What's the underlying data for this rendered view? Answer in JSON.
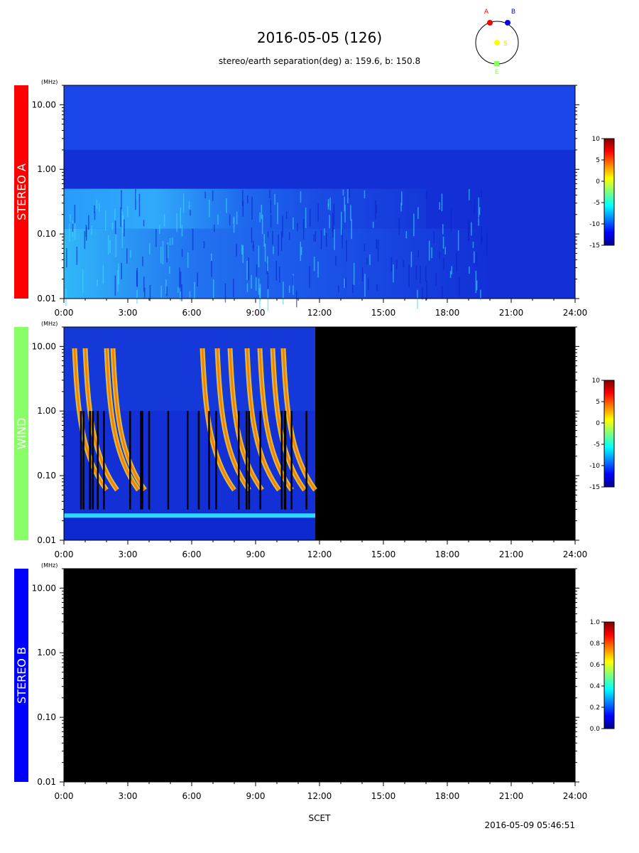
{
  "header": {
    "title": "2016-05-05 (126)",
    "subtitle": "stereo/earth separation(deg) a: 159.6, b: 150.8"
  },
  "orbit": {
    "labels": [
      "A",
      "B",
      "S",
      "E"
    ]
  },
  "footer": {
    "xlabel": "SCET",
    "timestamp": "2016-05-09 05:46:51"
  },
  "chart_data": [
    {
      "type": "heatmap",
      "panel": "STEREO A",
      "panel_color": "#ff0000",
      "panel_text_color": "#ffffff",
      "y_unit_label": "(MHz)",
      "yscale": "log",
      "ylim": [
        0.01,
        20
      ],
      "yticks": [
        10,
        1,
        0.1,
        0.01
      ],
      "ytick_labels": [
        "10.00",
        "1.00",
        "0.10",
        "0.01"
      ],
      "xlim": [
        0,
        24
      ],
      "xticks": [
        0,
        3,
        6,
        9,
        12,
        15,
        18,
        21,
        24
      ],
      "xtick_labels": [
        "0:00",
        "3:00",
        "6:00",
        "9:00",
        "12:00",
        "15:00",
        "18:00",
        "21:00",
        "24:00"
      ],
      "data_end_hour": 24,
      "colorbar": {
        "range": [
          -15,
          10
        ],
        "ticks": [
          10,
          5,
          0,
          -5,
          -10,
          -15
        ],
        "tick_labels": [
          "10",
          "5",
          "0",
          "-5",
          "-10",
          "-15"
        ]
      }
    },
    {
      "type": "heatmap",
      "panel": "WIND",
      "panel_color": "#88ff66",
      "panel_text_color": "#ffffff",
      "y_unit_label": "(MHz)",
      "yscale": "log",
      "ylim": [
        0.01,
        20
      ],
      "yticks": [
        10,
        1,
        0.1,
        0.01
      ],
      "ytick_labels": [
        "10.00",
        "1.00",
        "0.10",
        "0.01"
      ],
      "xlim": [
        0,
        24
      ],
      "xticks": [
        0,
        3,
        6,
        9,
        12,
        15,
        18,
        21,
        24
      ],
      "xtick_labels": [
        "0:00",
        "3:00",
        "6:00",
        "9:00",
        "12:00",
        "15:00",
        "18:00",
        "21:00",
        "24:00"
      ],
      "data_end_hour": 11.8,
      "bursts_hours": [
        0.5,
        1.0,
        2.0,
        2.3,
        6.5,
        7.2,
        7.8,
        8.6,
        9.2,
        9.8,
        10.3
      ],
      "colorbar": {
        "range": [
          -15,
          10
        ],
        "ticks": [
          10,
          5,
          0,
          -5,
          -10,
          -15
        ],
        "tick_labels": [
          "10",
          "5",
          "0",
          "-5",
          "-10",
          "-15"
        ]
      }
    },
    {
      "type": "heatmap",
      "panel": "STEREO B",
      "panel_color": "#0000ff",
      "panel_text_color": "#ffffff",
      "y_unit_label": "(MHz)",
      "yscale": "log",
      "ylim": [
        0.01,
        20
      ],
      "yticks": [
        10,
        1,
        0.1,
        0.01
      ],
      "ytick_labels": [
        "10.00",
        "1.00",
        "0.10",
        "0.01"
      ],
      "xlim": [
        0,
        24
      ],
      "xticks": [
        0,
        3,
        6,
        9,
        12,
        15,
        18,
        21,
        24
      ],
      "xtick_labels": [
        "0:00",
        "3:00",
        "6:00",
        "9:00",
        "12:00",
        "15:00",
        "18:00",
        "21:00",
        "24:00"
      ],
      "data_end_hour": 0,
      "colorbar": {
        "range": [
          0.0,
          1.0
        ],
        "ticks": [
          1.0,
          0.8,
          0.6,
          0.4,
          0.2,
          0.0
        ],
        "tick_labels": [
          "1.0",
          "0.8",
          "0.6",
          "0.4",
          "0.2",
          "0.0"
        ]
      }
    }
  ]
}
